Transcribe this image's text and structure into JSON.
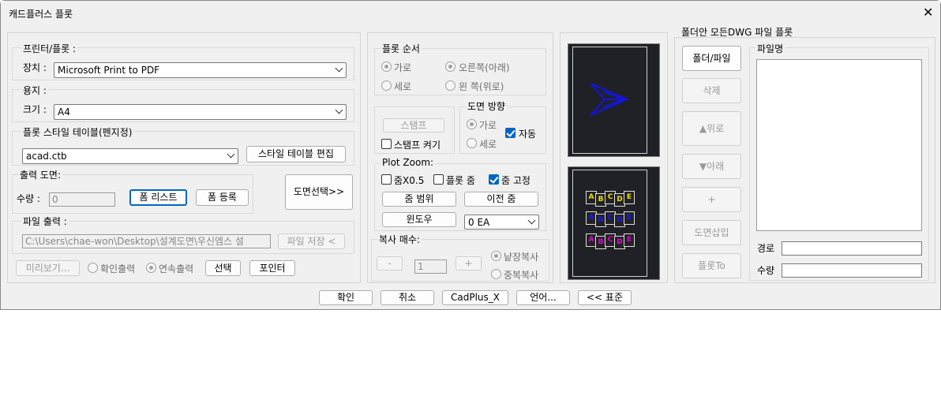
{
  "window": {
    "title": "캐드플러스 플롯",
    "close_label": "✕"
  },
  "printer": {
    "section_label": "프린터/플롯 :",
    "device_label": "장치 :",
    "device_value": "Microsoft Print to PDF",
    "paper_section_label": "용지 :",
    "size_label": "크기 :",
    "size_value": "A4",
    "style_section_label": "플롯 스타일 테이블(펜지정)",
    "style_value": "acad.ctb",
    "style_edit_button": "스타일 테이블 편집"
  },
  "output_drawing": {
    "section_label": "출력 도면:",
    "quantity_label": "수량 :",
    "quantity_value": "0",
    "form_list_button": "폼 리스트",
    "form_register_button": "폼 등록",
    "select_drawing_button": "도면선택>>"
  },
  "file_output": {
    "section_label": "파일 출력 :",
    "path_value": "C:\\Users\\chae-won\\Desktop\\설계도면\\우신엠스 설",
    "save_button": "파일 저장 <"
  },
  "bottom_left": {
    "preview_button": "미리보기...",
    "confirm_output_label": "확인출력",
    "continuous_output_label": "연속출력",
    "select_button": "선택",
    "pointer_button": "포인터"
  },
  "plot_order": {
    "section_label": "플롯 순서",
    "horizontal_label": "가로",
    "vertical_label": "세로",
    "right_down_label": "오른쪽(아래)",
    "left_up_label": "왼 쪽(위로)"
  },
  "stamp": {
    "stamp_button": "스탬프",
    "stamp_on_label": "스탬프 켜기"
  },
  "orientation": {
    "section_label": "도면 방향",
    "landscape_label": "가로",
    "portrait_label": "세로",
    "auto_label": "자동"
  },
  "plot_zoom": {
    "section_label": "Plot Zoom:",
    "zoom_half_label": "줌X0.5",
    "plot_zoom_label": "플롯 줌",
    "zoom_fixed_label": "줌 고정",
    "zoom_range_button": "줌 범위",
    "prev_zoom_button": "이전 줌",
    "window_button": "윈도우",
    "ea_value": "0 EA"
  },
  "copies": {
    "section_label": "복사 매수:",
    "minus_label": "-",
    "value": "1",
    "plus_label": "+",
    "single_copy_label": "낱장복사",
    "multi_copy_label": "중복복사"
  },
  "preview": {
    "letters_row1": [
      "A",
      "B",
      "C",
      "D",
      "E"
    ],
    "letters_row2": [
      "A",
      "B",
      "C",
      "D",
      "E"
    ],
    "letters_row3": [
      "A",
      "B",
      "C",
      "D",
      "E"
    ],
    "colors": {
      "yellow": "#e8e000",
      "blue": "#1a1aff",
      "magenta": "#e000e0",
      "arrow": "#1414e0"
    }
  },
  "folder_plot": {
    "section_label": "폴더안 모든DWG 파일 플롯",
    "folder_file_button": "폴더/파일",
    "delete_button": "삭제",
    "up_button": "▲위로",
    "down_button": "▼아래",
    "plus_button": "+",
    "insert_drawing_button": "도면삽입",
    "plot_to_button": "플롯To",
    "file_name_label": "파일명",
    "path_label": "경로",
    "quantity_label": "수량"
  },
  "footer": {
    "ok_button": "확인",
    "cancel_button": "취소",
    "cadplus_button": "CadPlus_X",
    "language_button": "언어...",
    "standard_button": "<< 표준"
  }
}
